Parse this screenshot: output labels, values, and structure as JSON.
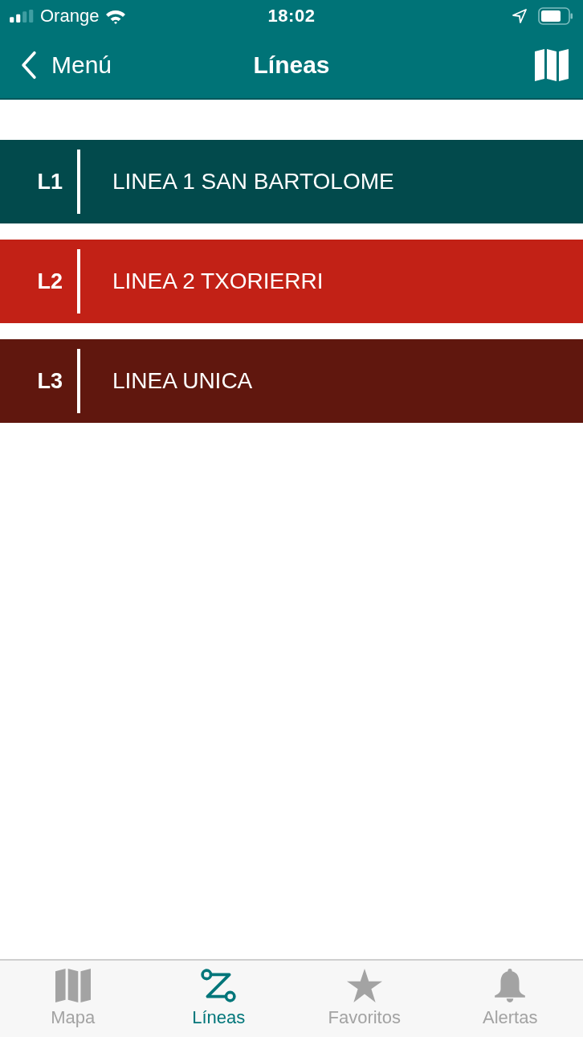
{
  "status_bar": {
    "carrier": "Orange",
    "time": "18:02"
  },
  "nav_bar": {
    "back_label": "Menú",
    "title": "Líneas"
  },
  "lines": [
    {
      "code": "L1",
      "name": "LINEA 1 SAN BARTOLOME",
      "color": "#024a4c"
    },
    {
      "code": "L2",
      "name": "LINEA 2 TXORIERRI",
      "color": "#c22116"
    },
    {
      "code": "L3",
      "name": "LINEA UNICA",
      "color": "#60170e"
    }
  ],
  "tab_bar": {
    "tabs": [
      {
        "label": "Mapa",
        "selected": false
      },
      {
        "label": "Líneas",
        "selected": true
      },
      {
        "label": "Favoritos",
        "selected": false
      },
      {
        "label": "Alertas",
        "selected": false
      }
    ]
  }
}
